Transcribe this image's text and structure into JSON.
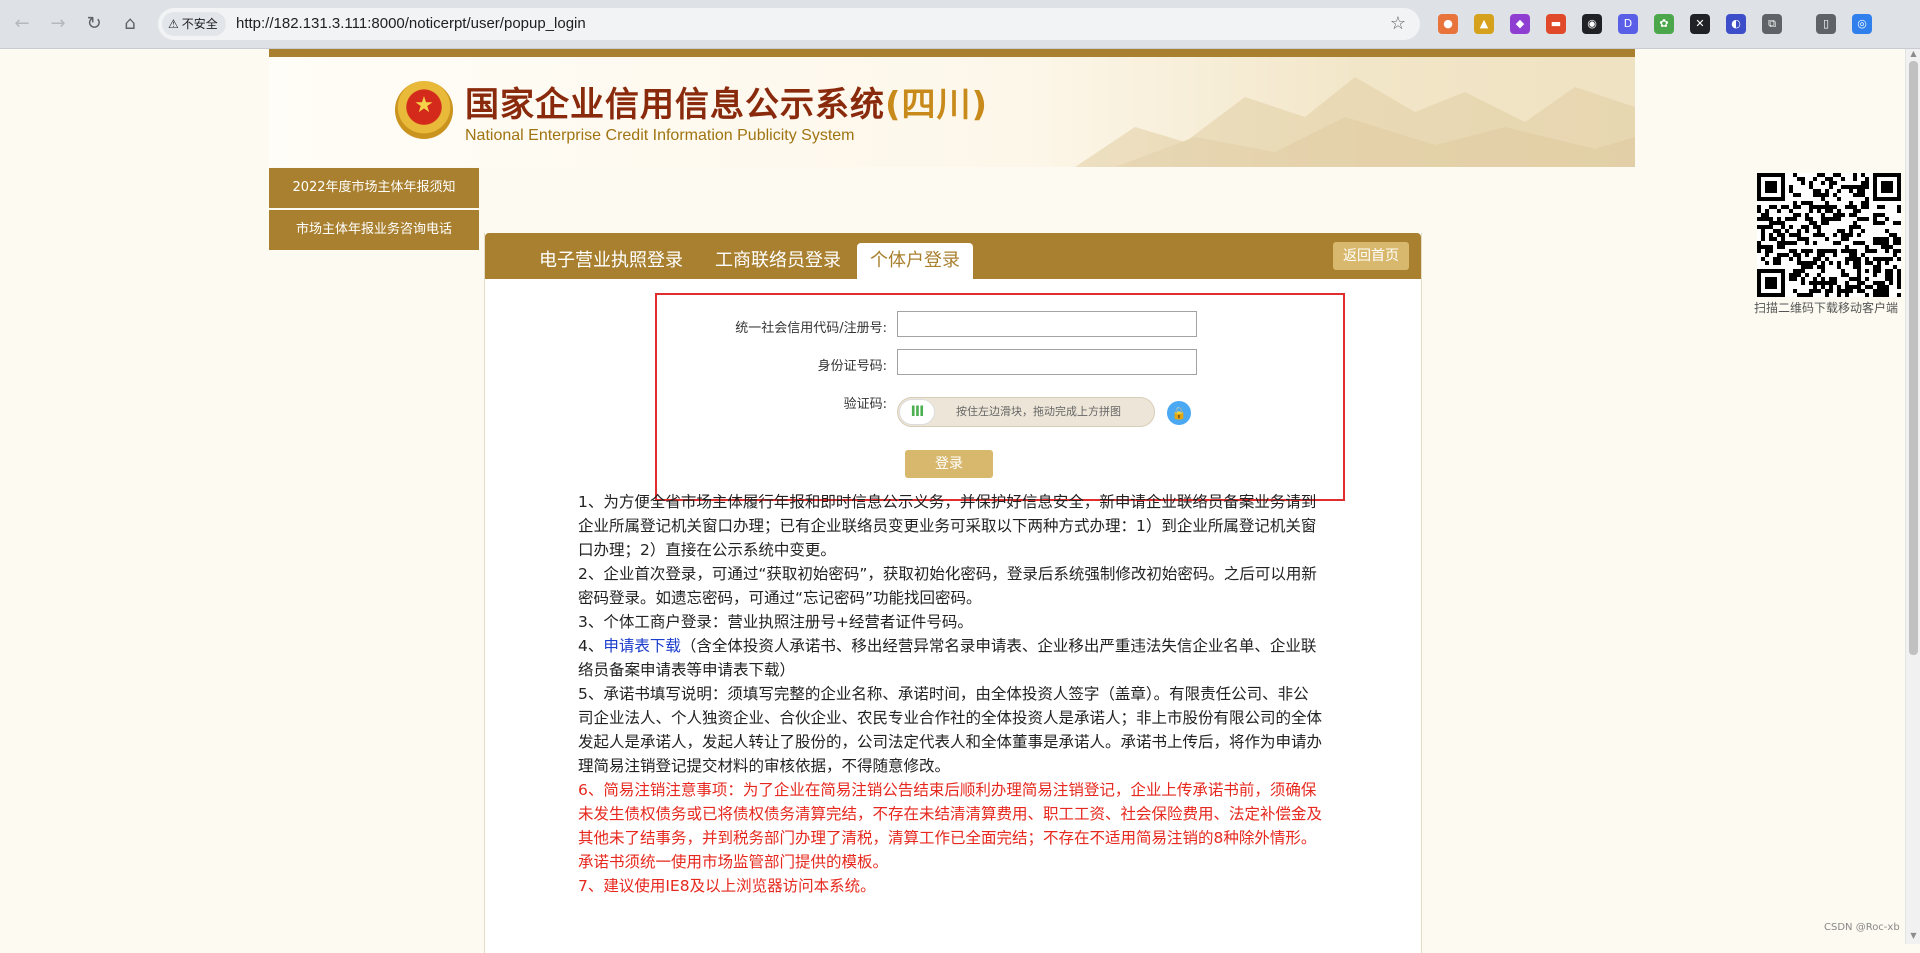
{
  "browser": {
    "insecure_label": "不安全",
    "url": "http://182.131.3.111:8000/noticerpt/user/popup_login",
    "extensions": [
      {
        "label": "●",
        "color": "#e8743b"
      },
      {
        "label": "▲",
        "color": "#d6a21e"
      },
      {
        "label": "◆",
        "color": "#8e3fd1"
      },
      {
        "label": "▬",
        "color": "#e04a2a"
      },
      {
        "label": "◉",
        "color": "#202124"
      },
      {
        "label": "D",
        "color": "#5a5fe8"
      },
      {
        "label": "✿",
        "color": "#4ca64c"
      },
      {
        "label": "✕",
        "color": "#202124"
      },
      {
        "label": "◐",
        "color": "#3d4cc9"
      },
      {
        "label": "⧉",
        "color": "#5f6368"
      },
      {
        "label": "▯",
        "color": "#5f6368"
      },
      {
        "label": "◎",
        "color": "#2f80ed"
      }
    ]
  },
  "header": {
    "title_cn": "国家企业信用信息公示系统",
    "province": "(四川)",
    "title_en": "National Enterprise Credit Information Publicity System"
  },
  "sidebar": {
    "items": [
      {
        "label": "2022年度市场主体年报须知"
      },
      {
        "label": "市场主体年报业务咨询电话"
      }
    ]
  },
  "tabs": {
    "items": [
      {
        "label": "电子营业执照登录"
      },
      {
        "label": "工商联络员登录"
      },
      {
        "label": "个体户登录"
      }
    ],
    "back_home": "返回首页"
  },
  "form": {
    "credit_code_label": "统一社会信用代码/注册号:",
    "credit_code_value": "",
    "id_label": "身份证号码:",
    "id_value": "",
    "captcha_label": "验证码:",
    "slider_text": "按住左边滑块，拖动完成上方拼图",
    "login_label": "登录"
  },
  "notes": {
    "n1": "1、为方便全省市场主体履行年报和即时信息公示义务，并保护好信息安全，新申请企业联络员备案业务请到企业所属登记机关窗口办理；已有企业联络员变更业务可采取以下两种方式办理：1）到企业所属登记机关窗口办理；2）直接在公示系统中变更。",
    "n2": "2、企业首次登录，可通过“获取初始密码”，获取初始化密码，登录后系统强制修改初始密码。之后可以用新密码登录。如遗忘密码，可通过“忘记密码”功能找回密码。",
    "n3": "3、个体工商户登录：营业执照注册号+经营者证件号码。",
    "n4_prefix": "4、",
    "n4_link": "申请表下载",
    "n4_rest": "（含全体投资人承诺书、移出经营异常名录申请表、企业移出严重违法失信企业名单、企业联络员备案申请表等申请表下载）",
    "n5": "5、承诺书填写说明：须填写完整的企业名称、承诺时间，由全体投资人签字（盖章）。有限责任公司、非公司企业法人、个人独资企业、合伙企业、农民专业合作社的全体投资人是承诺人；非上市股份有限公司的全体发起人是承诺人，发起人转让了股份的，公司法定代表人和全体董事是承诺人。承诺书上传后，将作为申请办理简易注销登记提交材料的审核依据，不得随意修改。",
    "n6": "6、简易注销注意事项：为了企业在简易注销公告结束后顺利办理简易注销登记，企业上传承诺书前，须确保未发生债权债务或已将债权债务清算完结，不存在未结清清算费用、职工工资、社会保险费用、法定补偿金及其他未了结事务，并到税务部门办理了清税，清算工作已全面完结；不存在不适用简易注销的8种除外情形。承诺书须统一使用市场监管部门提供的模板。",
    "n7": "7、建议使用IE8及以上浏览器访问本系统。"
  },
  "qr": {
    "caption": "扫描二维码下载移动客户端"
  },
  "watermark": "CSDN @Roc-xb"
}
